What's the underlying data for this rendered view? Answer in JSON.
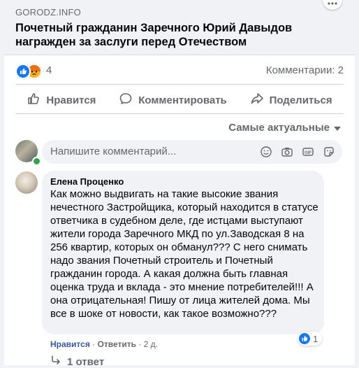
{
  "post": {
    "domain": "GORODZ.INFO",
    "headline": "Почетный гражданин Заречного Юрий Давыдов награжден за заслуги перед Отечеством",
    "reaction_count": "4",
    "comments_count": "Комментарии: 2"
  },
  "actions": {
    "like": "Нравится",
    "comment": "Комментировать",
    "share": "Поделиться"
  },
  "sort": {
    "label": "Самые актуальные"
  },
  "composer": {
    "placeholder": "Напишите комментарий..."
  },
  "comment": {
    "author": "Елена Проценко",
    "text": "Как можно выдвигать на такие высокие звания нечестного Застройщика, который находится в статусе ответчика в судебном деле, где истцами выступают жители города Заречного МКД по ул.Заводская 8 на 256 квартир, которых он обманул??? С него снимать надо звания Почетный строитель и Почетный гражданин города. А какая должна быть главная оценка труда и вклада - это мнение потребителей!!! А она отрицательная! Пишу от лица жителей дома. Мы все в шоке от новости, как такое возможно???",
    "like_action": "Нравится",
    "reply_action": "Ответить",
    "time": "2 д.",
    "like_count": "1",
    "replies_label": "1 ответ"
  },
  "colors": {
    "accent": "#1877f2",
    "muted": "#65676b",
    "bubble": "#f0f2f5"
  },
  "icons": [
    "more-icon",
    "like-reaction-icon",
    "angry-reaction-icon",
    "thumbs-up-icon",
    "comment-icon",
    "share-icon",
    "caret-down-icon",
    "emoji-icon",
    "camera-icon",
    "gif-icon",
    "sticker-icon",
    "reply-arrow-icon"
  ]
}
